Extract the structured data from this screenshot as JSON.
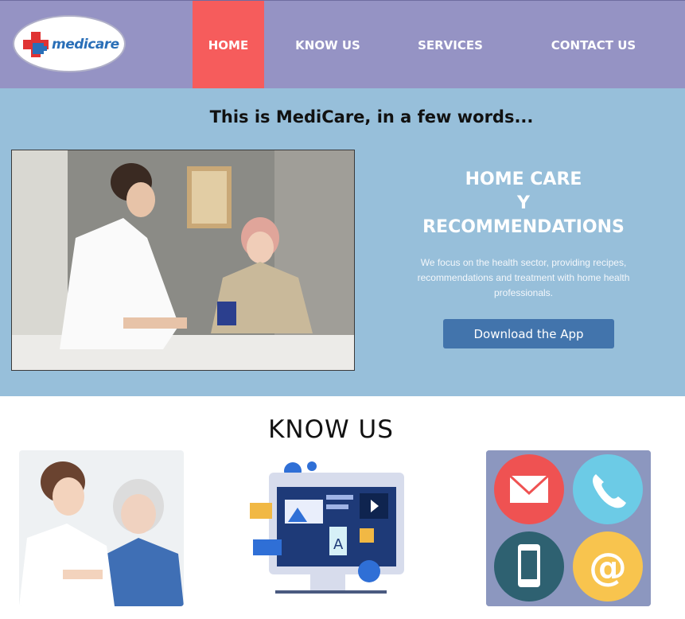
{
  "brand": {
    "name": "medicare"
  },
  "nav": {
    "items": [
      {
        "label": "HOME",
        "active": true
      },
      {
        "label": "KNOW US",
        "active": false
      },
      {
        "label": "SERVICES",
        "active": false
      },
      {
        "label": "CONTACT US",
        "active": false
      }
    ]
  },
  "hero": {
    "title": "This is MediCare, in a few words...",
    "heading_line1": "HOME CARE",
    "heading_line2": "Y",
    "heading_line3": "RECOMMENDATIONS",
    "description": "We focus on the health sector, providing recipes, recommendations and treatment with home health professionals.",
    "button_label": "Download the App"
  },
  "know_us": {
    "title": "KNOW US"
  },
  "colors": {
    "nav_bg": "#9593c4",
    "nav_active": "#f65c5c",
    "hero_bg": "#97bfda",
    "button": "#4274ac"
  },
  "icons": [
    "medical-cross-icon",
    "mail-icon",
    "phone-icon",
    "mobile-icon",
    "at-sign-icon"
  ]
}
